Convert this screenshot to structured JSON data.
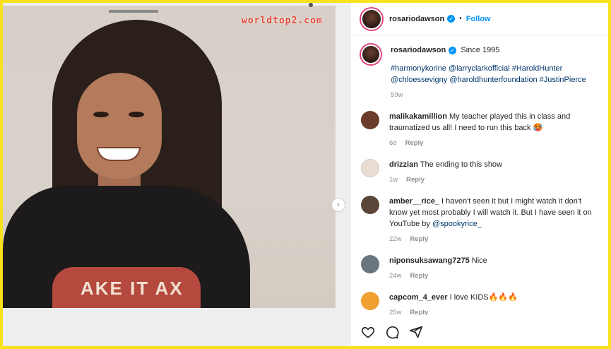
{
  "watermark": "worldtop2.com",
  "photo": {
    "shirt_text": "AKE IT     AX",
    "next_icon": "chevron-right-icon"
  },
  "post": {
    "author": "rosariodawson",
    "follow_label": "Follow",
    "caption_author": "rosariodawson",
    "caption_text": "Since 1995",
    "tags_line1": "#harmonykorine @larryclarkofficial #HaroldHunter",
    "tags_line2": "@chloessevigny @haroldhunterfoundation #JustinPierce",
    "age": "59w"
  },
  "comments": [
    {
      "user": "malikakamillion",
      "text": "My teacher played this in class and traumatized us all! I need to run this back 🥵",
      "age": "6d",
      "reply": "Reply",
      "avatar_color": "#6b3b2b"
    },
    {
      "user": "drizzian",
      "text": "The ending to this show",
      "age": "1w",
      "reply": "Reply",
      "avatar_color": "#e9dcd0"
    },
    {
      "user": "amber__rice_",
      "text": "I haven't seen it but I might watch it don't know yet most probably I will watch it. But I have seen it on YouTube by",
      "mention": "@spookyrice_",
      "age": "22w",
      "reply": "Reply",
      "avatar_color": "#5a4538"
    },
    {
      "user": "niponsuksawang7275",
      "text": "Nice",
      "age": "24w",
      "reply": "Reply",
      "avatar_color": "#6a7580"
    },
    {
      "user": "capcom_4_ever",
      "text": "I love KIDS🔥🔥🔥",
      "age": "25w",
      "reply": "Reply",
      "avatar_color": "#f0a030"
    }
  ],
  "actions": [
    "heart-icon",
    "comment-icon",
    "share-icon"
  ]
}
